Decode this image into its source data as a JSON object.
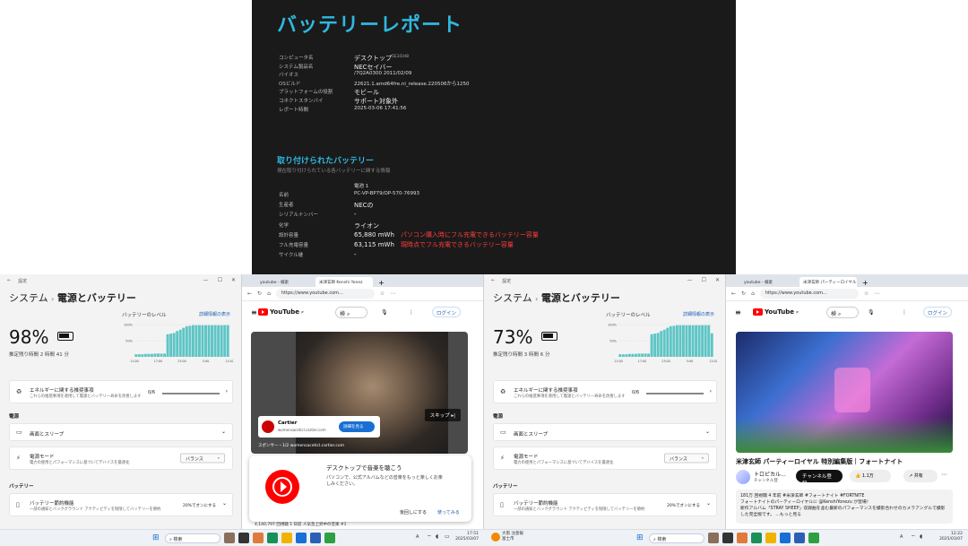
{
  "report": {
    "title": "バッテリーレポート",
    "system": [
      {
        "key": "コンピュータ名",
        "value": "デスクトップ",
        "suffix": "5E3I1H8"
      },
      {
        "key": "システム製品名",
        "value": "NECセイバー"
      },
      {
        "key": "バイオス",
        "value": "/7Q2A0300 2011/02/09"
      },
      {
        "key": "OSビルド",
        "value": "22621.1.amd64fre.ni_release.220506から1250"
      },
      {
        "key": "プラットフォームの役割",
        "value": "モビール"
      },
      {
        "key": "コネクトスタンバイ",
        "value": "サポート対象外"
      },
      {
        "key": "レポート時間",
        "value": "2025-03-06 17:41:56"
      }
    ],
    "installed_heading": "取り付けられたバッテリー",
    "installed_sub": "現在取り付けられている各バッテリーに関する情報",
    "battery_header": "電池 1",
    "battery": [
      {
        "key": "名前",
        "value": "PC-VP-BP79/OP-570-76993"
      },
      {
        "key": "生産者",
        "value": "NECの"
      },
      {
        "key": "シリアルナンバー",
        "value": "-"
      },
      {
        "key": "化学",
        "value": "ライオン"
      },
      {
        "key": "設計容量",
        "value": "65,880 mWh",
        "note": "パソコン購入時にフル充電できるバッテリー容量"
      },
      {
        "key": "フル充電容量",
        "value": "63,115 mWh",
        "note": "現時点でフル充電できるバッテリー容量"
      },
      {
        "key": "サイクル継 ",
        "value": "-"
      }
    ]
  },
  "settings_left": {
    "window_title": "設定",
    "breadcrumb_a": "システム",
    "breadcrumb_b": "電源とバッテリー",
    "percent": "98%",
    "remaining": "推定残り時間 2 時間 41 分",
    "level_label": "バッテリーのレベル",
    "detail_link": "詳細情報の表示",
    "y_ticks": [
      "100%",
      "50%"
    ],
    "x_ticks": [
      "11:00",
      "17:00",
      "23:00",
      "5:00",
      "11:00"
    ],
    "eco_title": "エネルギーに関する推奨事項",
    "eco_desc": "これらの推奨事項を適用して電源とバッテリー寿命を改善します",
    "eco_value": "0/6",
    "power_section": "電源",
    "screen_sleep": "画面とスリープ",
    "power_mode": "電源モード",
    "power_mode_desc": "電力の使用とパフォーマンスに基づいてデバイスを最適化",
    "power_mode_value": "バランス",
    "battery_section": "バッテリー",
    "saver": "バッテリー節約機能",
    "saver_desc": "一部の通知とバックグラウンド アクティビティを制限してバッテリーを節約",
    "saver_value": "20%でオンにする"
  },
  "settings_right": {
    "window_title": "設定",
    "breadcrumb_a": "システム",
    "breadcrumb_b": "電源とバッテリー",
    "percent": "73%",
    "remaining": "推定残り時間 3 時間 6 分",
    "level_label": "バッテリーのレベル",
    "detail_link": "詳細情報の表示",
    "y_ticks": [
      "100%",
      "50%"
    ],
    "x_ticks": [
      "11:00",
      "17:00",
      "23:00",
      "5:00",
      "11:00"
    ],
    "eco_title": "エネルギーに関する推奨事項",
    "eco_desc": "これらの推奨事項を適用して電源とバッテリー寿命を改善します",
    "eco_value": "0/6",
    "power_section": "電源",
    "screen_sleep": "画面とスリープ",
    "power_mode": "電源モード",
    "power_mode_desc": "電力の使用とパフォーマンスに基づいてデバイスを最適化",
    "power_mode_value": "バランス",
    "battery_section": "バッテリー",
    "saver": "バッテリー節約機能",
    "saver_desc": "一部の通知とバックグラウンド アクティビティを制限してバッテリーを節約",
    "saver_value": "20%でオンにする"
  },
  "browser_left": {
    "tab1": "youtube - 検索",
    "tab2": "米津玄師 Kenshi Yonez",
    "url": "https://www.youtube.com...",
    "yt": "YouTube",
    "yt_sup": "JP",
    "search_text": "検",
    "login": "ログイン",
    "ad_brand": "Cartier",
    "ad_domain": "womensaceticl.cartier.com",
    "ad_button": "詳細を見る",
    "skip": "スキップ",
    "sponsor": "スポンサー・1/2",
    "sponsor_domain": "womensaceticl.cartier.com",
    "popup_title": "デスクトップで音楽を聴こう",
    "popup_body": "パソコンで、公式アルバムなどの音楽をもっと楽しくお楽しみください。",
    "popup_no": "後回しにする",
    "popup_yes": "使ってみる",
    "views": "4,140,797 回視聴 1 日前 人気急上昇中の音楽 #1"
  },
  "browser_right": {
    "tab1": "youtube - 検索",
    "tab2": "米津玄師 パーティーロイヤル",
    "url": "https://www.youtube.com...",
    "yt": "YouTube",
    "yt_sup": "JP",
    "search_text": "検",
    "login": "ログイン",
    "video_title": "米津玄師 パーティーロイヤル 特別編集版｜フォートナイト",
    "channel": "トロピカル...",
    "channel_sub": "チャンネル登録",
    "subscribers": "チャンネル登",
    "likes": "1.1万",
    "share": "共有",
    "desc_line1": "181万 回視聴 4 年前 #米津玄師 #フォートナイト #FORTNITE",
    "desc_line2": "フォートナイトのパーティーロイヤルに @KenshiYonezu が登場！",
    "desc_line3": "新作アルバム「STRAY SHEEP」収録曲を含む最新のパフォーマンスを撮影合わせのカメラアングルで撮影した完全版です。 ...もっと見る"
  },
  "taskbar": {
    "search": "検索",
    "time_left": "17:51",
    "date_left": "2025/03/07",
    "notice": "大雨 注意報",
    "notice_sub": "富士市",
    "time_right": "12:22",
    "date_right": "2025/03/07",
    "ime": "A"
  },
  "colors": {
    "accent": "#2fb8e0",
    "red": "#ff3c3c",
    "yt_red": "#ff0000",
    "chart": "#5ec5c5"
  },
  "chart_left": [
    8,
    8,
    8,
    9,
    9,
    9,
    10,
    10,
    10,
    10,
    70,
    72,
    74,
    80,
    84,
    90,
    95,
    96,
    98,
    98,
    98,
    98,
    98,
    98,
    98,
    98,
    98,
    98,
    98,
    98
  ],
  "chart_right": [
    8,
    8,
    8,
    9,
    9,
    9,
    10,
    10,
    10,
    10,
    70,
    72,
    74,
    80,
    84,
    90,
    95,
    96,
    98,
    98,
    98,
    98,
    98,
    98,
    98,
    98,
    98,
    98,
    98,
    73
  ]
}
